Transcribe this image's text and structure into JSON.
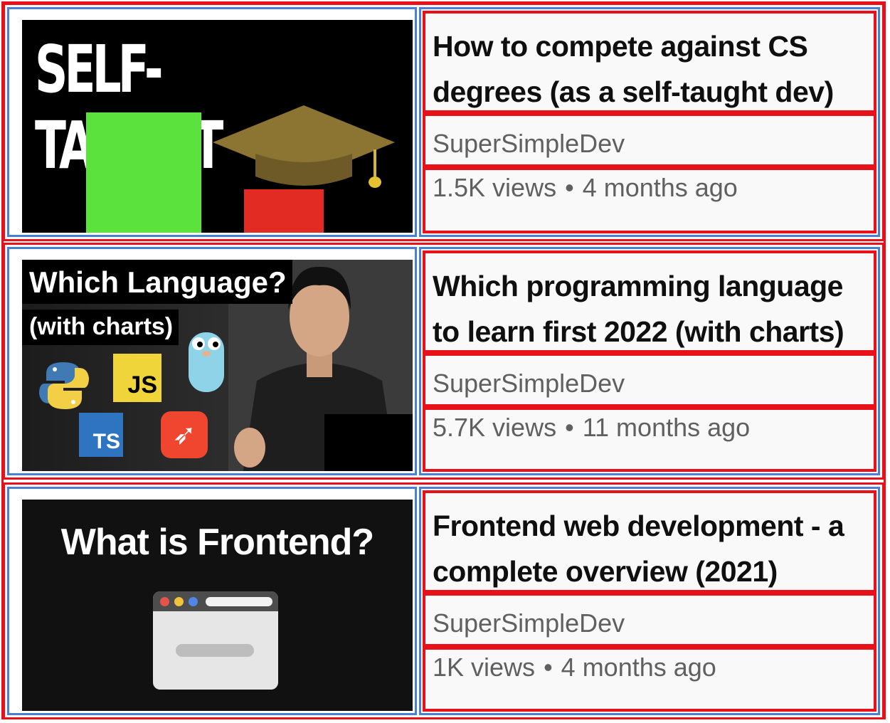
{
  "videos": [
    {
      "title": "How to compete against CS degrees (as a self-taught dev)",
      "channel": "SuperSimpleDev",
      "views": "1.5K views",
      "age": "4 months ago",
      "thumbnail": {
        "text": "SELF-TAUGHT"
      }
    },
    {
      "title": "Which programming language to learn first 2022 (with charts)",
      "channel": "SuperSimpleDev",
      "views": "5.7K views",
      "age": "11 months ago",
      "thumbnail": {
        "text": "Which Language?",
        "subtext": "(with charts)",
        "badges": {
          "js": "JS",
          "ts": "TS"
        }
      }
    },
    {
      "title": "Frontend web development - a complete overview (2021)",
      "channel": "SuperSimpleDev",
      "views": "1K views",
      "age": "4 months ago",
      "thumbnail": {
        "text": "What is Frontend?"
      }
    }
  ],
  "separator": "•",
  "colors": {
    "highlight_red": "#e8111a",
    "highlight_blue": "#4a7fd6",
    "meta_gray": "#606060"
  }
}
